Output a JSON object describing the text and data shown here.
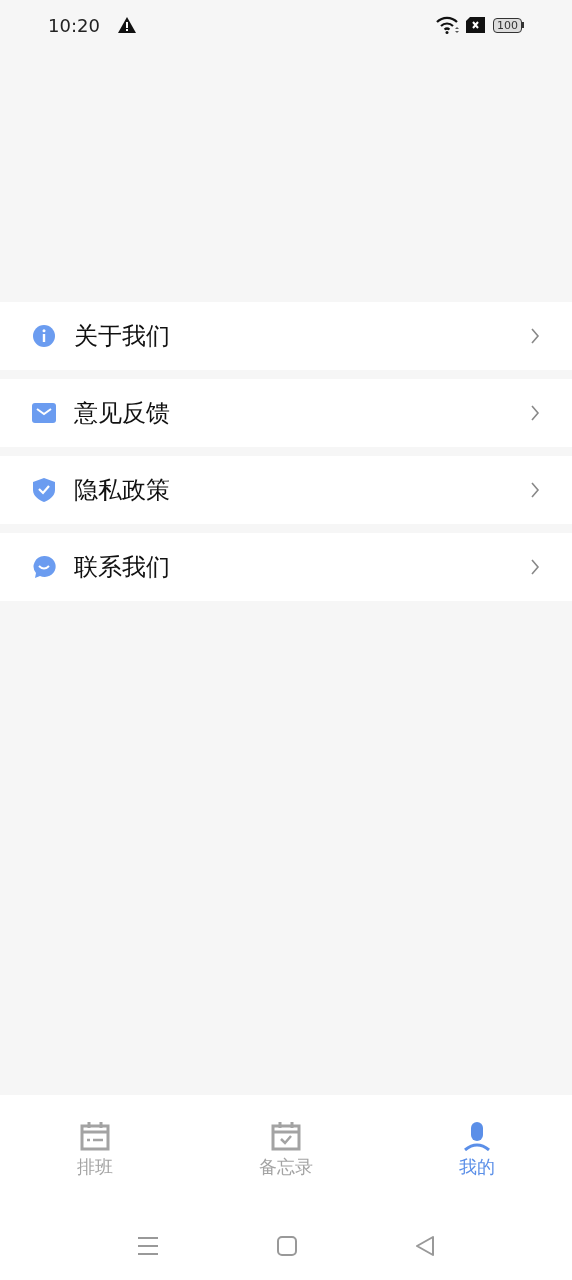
{
  "status_bar": {
    "time": "10:20",
    "battery": "100"
  },
  "menu": [
    {
      "kind": "info",
      "label": "关于我们"
    },
    {
      "kind": "mail",
      "label": "意见反馈"
    },
    {
      "kind": "shield",
      "label": "隐私政策"
    },
    {
      "kind": "chat",
      "label": "联系我们"
    }
  ],
  "tab_bar": [
    {
      "kind": "schedule",
      "label": "排班",
      "selected": false
    },
    {
      "kind": "memo",
      "label": "备忘录",
      "selected": false
    },
    {
      "kind": "profile",
      "label": "我的",
      "selected": true
    }
  ]
}
